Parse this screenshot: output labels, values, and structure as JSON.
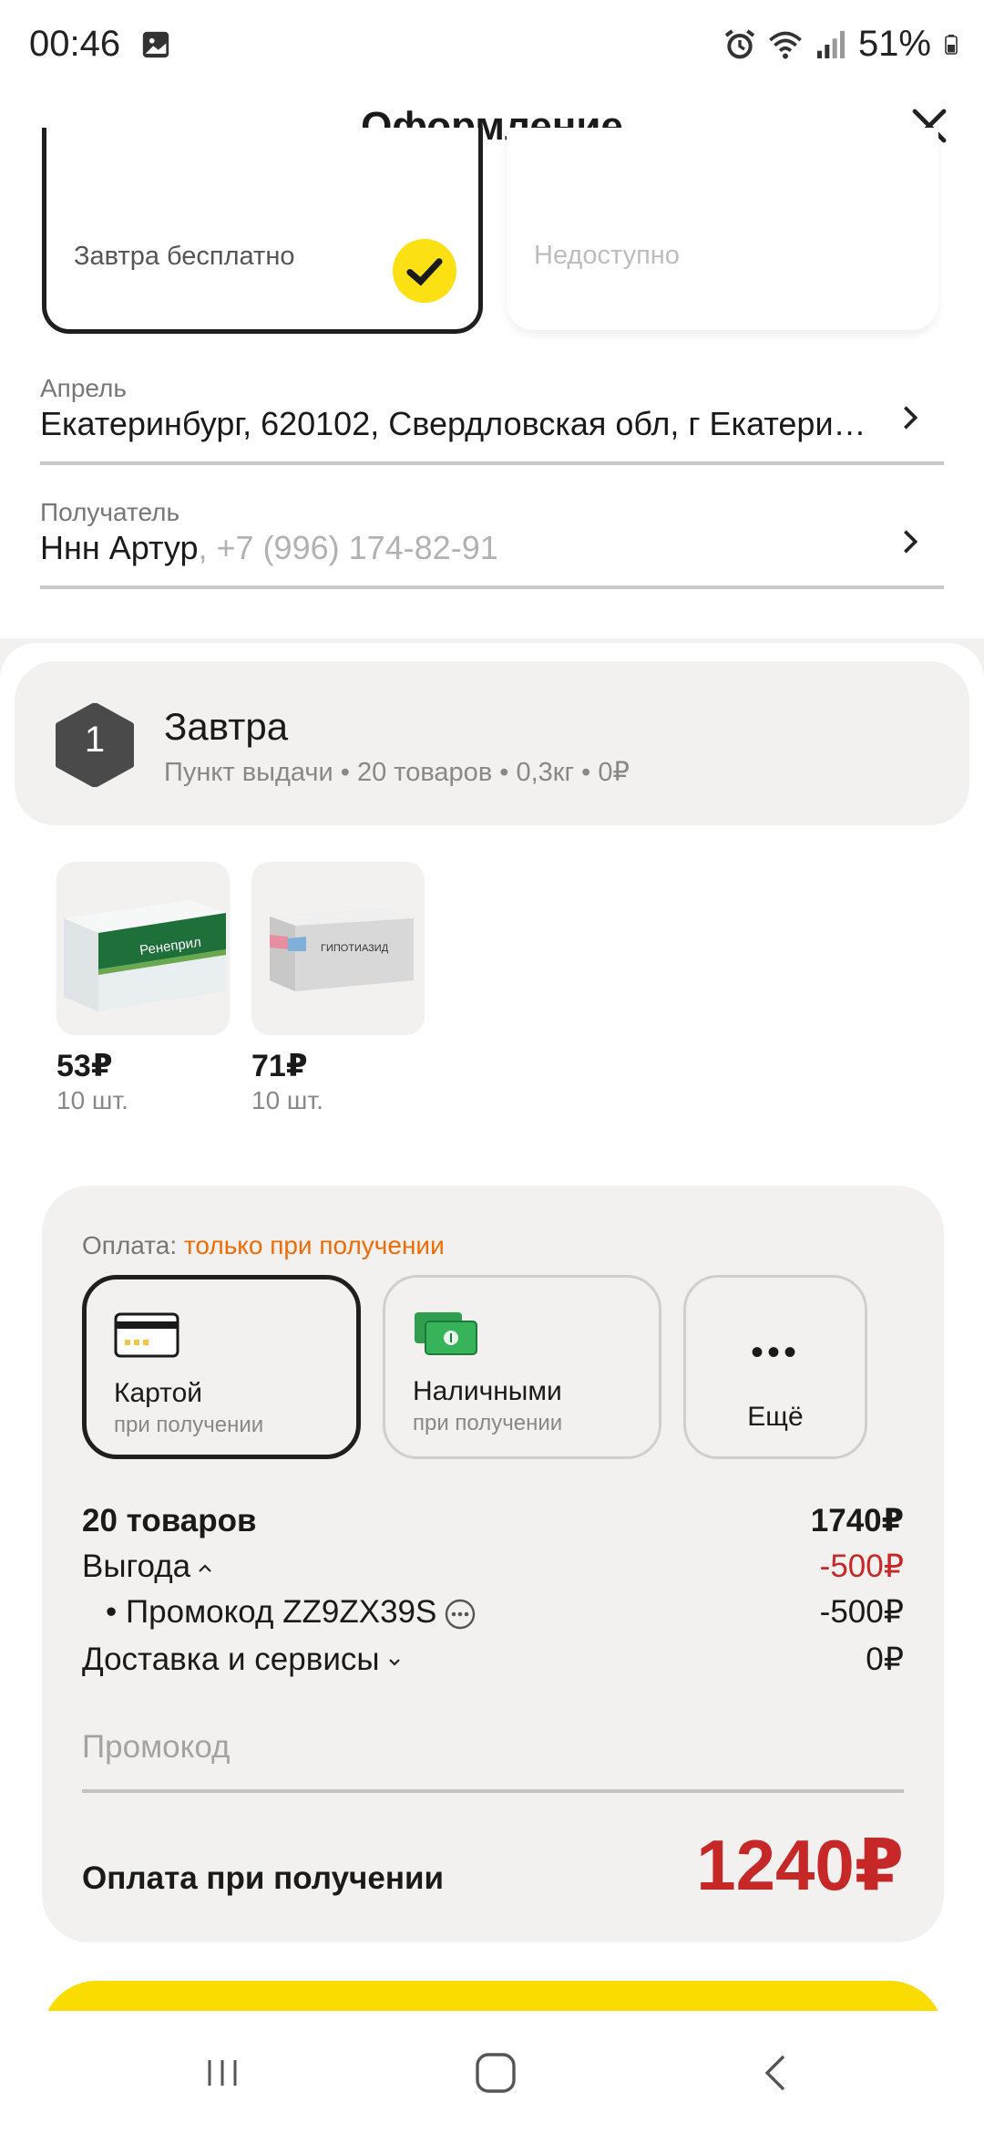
{
  "status": {
    "time": "00:46",
    "battery": "51%"
  },
  "header": {
    "title": "Оформление"
  },
  "delivery_options": [
    {
      "label": "Завтра бесплатно",
      "selected": true
    },
    {
      "label": "Недоступно",
      "selected": false
    }
  ],
  "address": {
    "caption": "Апрель",
    "value": "Екатеринбург, 620102, Свердловская обл, г Екатери…"
  },
  "recipient": {
    "caption": "Получатель",
    "name": "Ннн Артур",
    "phone": ", +7 (996) 174-82-91"
  },
  "shipment": {
    "number": "1",
    "title": "Завтра",
    "subtitle": "Пункт выдачи • 20 товаров • 0,3кг • 0₽",
    "products": [
      {
        "price": "53₽",
        "qty": "10 шт.",
        "image_text": "Ренеприл"
      },
      {
        "price": "71₽",
        "qty": "10 шт.",
        "image_text": "ГИПОТИАЗИД"
      }
    ]
  },
  "payment": {
    "label": "Оплата:",
    "label_accent": "только при получении",
    "options": [
      {
        "title": "Картой",
        "sub": "при получении",
        "icon": "credit-card-icon"
      },
      {
        "title": "Наличными",
        "sub": "при получении",
        "icon": "cash-icon"
      },
      {
        "title": "Ещё",
        "icon": "more-dots-icon"
      }
    ]
  },
  "summary": {
    "items_label": "20 товаров",
    "items_value": "1740₽",
    "benefit_label": "Выгода",
    "benefit_value": "-500₽",
    "promo_label": "• Промокод ZZ9ZX39S",
    "promo_value": "-500₽",
    "delivery_label": "Доставка и сервисы",
    "delivery_value": "0₽",
    "promo_placeholder": "Промокод",
    "total_label": "Оплата при получении",
    "total_value": "1240₽"
  },
  "colors": {
    "accent_yellow": "#fbdc00",
    "price_red": "#c62828",
    "warning_orange": "#f06b00"
  }
}
